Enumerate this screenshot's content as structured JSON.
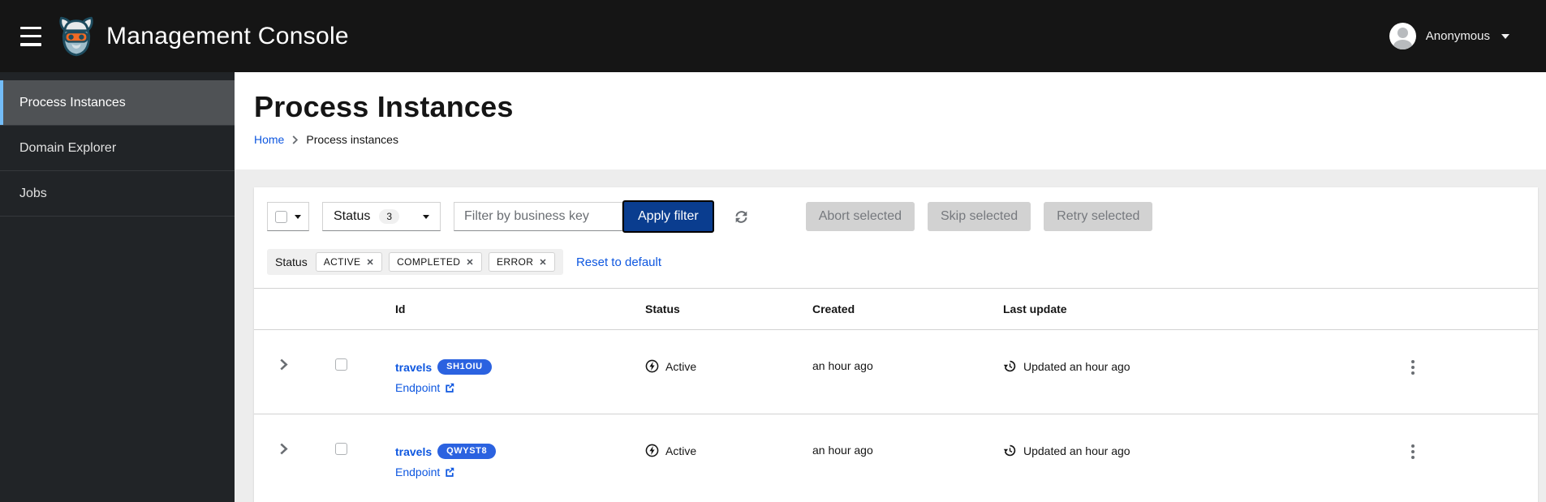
{
  "topbar": {
    "title": "Management Console",
    "user": "Anonymous"
  },
  "sidebar": {
    "items": [
      {
        "label": "Process Instances",
        "selected": true
      },
      {
        "label": "Domain Explorer",
        "selected": false
      },
      {
        "label": "Jobs",
        "selected": false
      }
    ]
  },
  "page": {
    "title": "Process Instances",
    "breadcrumb": [
      {
        "label": "Home",
        "link": true
      },
      {
        "label": "Process instances",
        "link": false
      }
    ]
  },
  "toolbar": {
    "status_dropdown_label": "Status",
    "status_dropdown_count": "3",
    "search_placeholder": "Filter by business key",
    "apply_button_label": "Apply filter",
    "bulk_actions": [
      "Abort selected",
      "Skip selected",
      "Retry selected"
    ]
  },
  "filters": {
    "group_label": "Status",
    "chips": [
      "ACTIVE",
      "COMPLETED",
      "ERROR"
    ],
    "chip_close_glyph": "✕",
    "reset_label": "Reset to default"
  },
  "table": {
    "columns": [
      "Id",
      "Status",
      "Created",
      "Last update"
    ],
    "rows": [
      {
        "name": "travels",
        "badge": "SH1OIU",
        "endpoint_label": "Endpoint",
        "status": "Active",
        "created": "an hour ago",
        "last_update": "Updated an hour ago"
      },
      {
        "name": "travels",
        "badge": "QWYST8",
        "endpoint_label": "Endpoint",
        "status": "Active",
        "created": "an hour ago",
        "last_update": "Updated an hour ago"
      }
    ]
  },
  "icons": {
    "hamburger": "menu-bars",
    "brand": "kogito-viking-head",
    "avatar": "user-silhouette",
    "caret_down": "triangle-down",
    "breadcrumb_separator": "angle-right",
    "refresh": "sync-circular-arrows",
    "status_active": "circled-lightning-bolt",
    "last_update": "history-clock-arrow",
    "endpoint": "external-link",
    "row_expand": "angle-right",
    "row_actions": "kebab-vertical-dots"
  },
  "colors": {
    "topbar_bg": "#151515",
    "sidebar_bg": "#212427",
    "sidebar_selected_bg": "#4f5255",
    "sidebar_accent": "#73bcf7",
    "page_bg": "#ededed",
    "card_bg": "#ffffff",
    "link_blue": "#0e57e0",
    "badge_blue": "#2b62e0",
    "primary_button_bg": "#0a3d8f",
    "disabled_button_bg": "#d2d2d2"
  }
}
